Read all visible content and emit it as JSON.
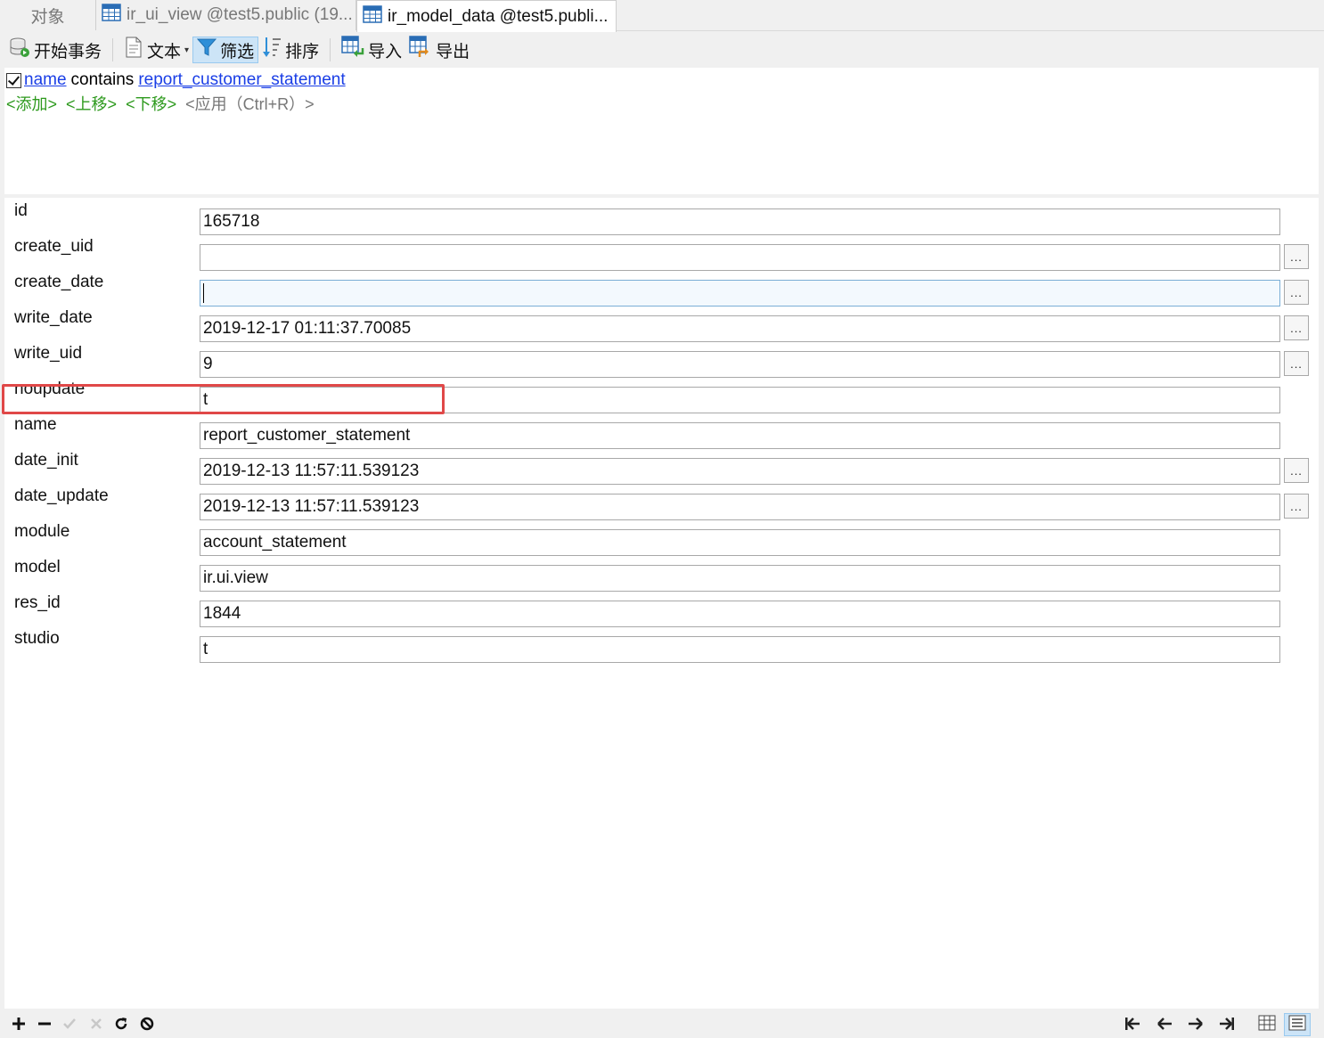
{
  "tabs": [
    {
      "label": "对象"
    },
    {
      "label": "ir_ui_view @test5.public (19..."
    },
    {
      "label": "ir_model_data @test5.publi..."
    }
  ],
  "toolbar": {
    "begin_transaction": "开始事务",
    "text": "文本",
    "filter": "筛选",
    "sort": "排序",
    "import": "导入",
    "export": "导出"
  },
  "filter": {
    "field": "name",
    "operator": "contains",
    "value": "report_customer_statement",
    "enabled": true,
    "add": "<添加>",
    "move_up": "<上移>",
    "move_down": "<下移>",
    "apply": "<应用（Ctrl+R）>"
  },
  "fields": [
    {
      "label": "id",
      "value": "165718"
    },
    {
      "label": "create_uid",
      "value": ""
    },
    {
      "label": "create_date",
      "value": ""
    },
    {
      "label": "write_date",
      "value": "2019-12-17 01:11:37.70085"
    },
    {
      "label": "write_uid",
      "value": "9"
    },
    {
      "label": "noupdate",
      "value": "t"
    },
    {
      "label": "name",
      "value": "report_customer_statement"
    },
    {
      "label": "date_init",
      "value": "2019-12-13 11:57:11.539123"
    },
    {
      "label": "date_update",
      "value": "2019-12-13 11:57:11.539123"
    },
    {
      "label": "module",
      "value": "account_statement"
    },
    {
      "label": "model",
      "value": "ir.ui.view"
    },
    {
      "label": "res_id",
      "value": "1844"
    },
    {
      "label": "studio",
      "value": "t"
    }
  ],
  "ellipsis_label": "...",
  "colors": {
    "highlight": "#e04848",
    "link": "#1a3ee6",
    "filter_action": "#2e9a1e",
    "pressed": "#cce4f7"
  },
  "icons": {
    "tabs": "table-icon",
    "toolbar": [
      "database-transaction-icon",
      "text-document-icon",
      "filter-funnel-icon",
      "sort-icon",
      "import-icon",
      "export-icon"
    ],
    "bottom": [
      "plus-icon",
      "minus-icon",
      "check-icon",
      "cross-icon",
      "refresh-icon",
      "stop-icon",
      "first-record-icon",
      "previous-record-icon",
      "next-record-icon",
      "last-record-icon",
      "grid-view-icon",
      "form-view-icon"
    ]
  }
}
